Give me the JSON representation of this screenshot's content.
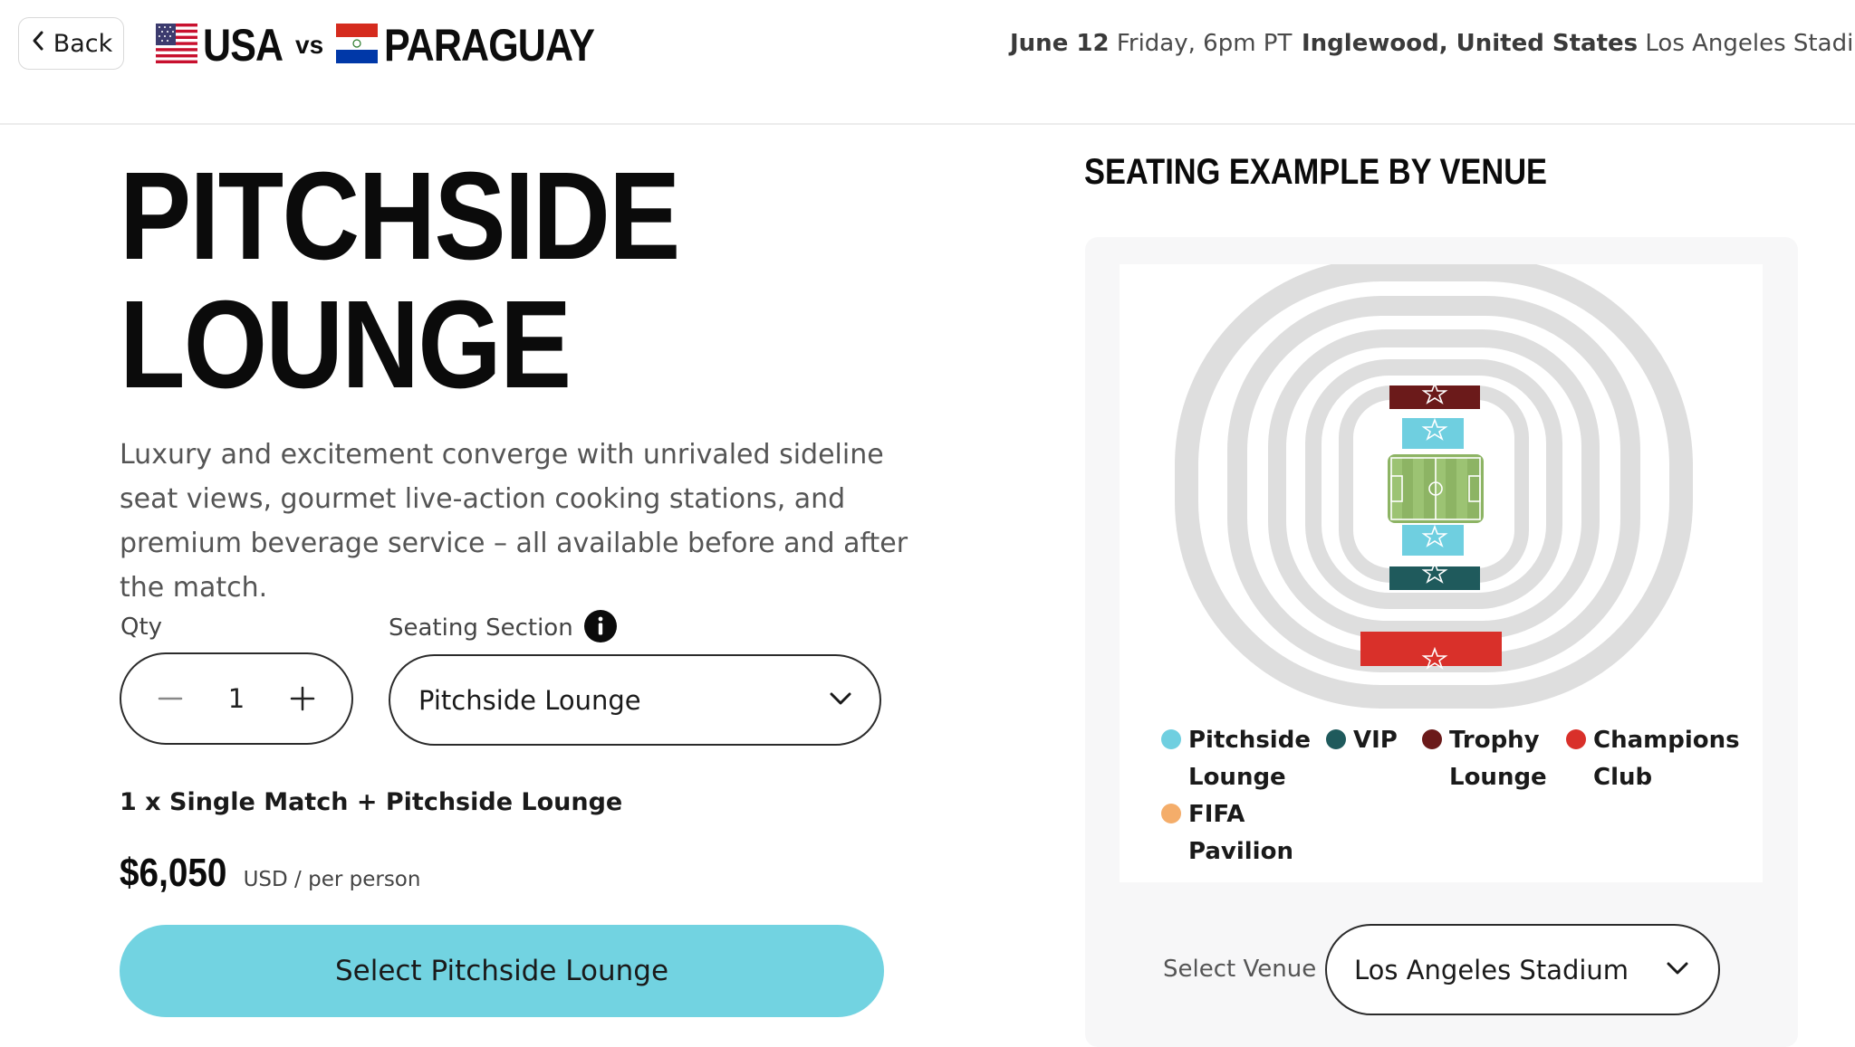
{
  "header": {
    "back_label": "Back",
    "team_home": "USA",
    "vs_label": "vs",
    "team_away": "PARAGUAY",
    "date_bold": "June 12",
    "date_rest": "Friday, 6pm PT",
    "location_bold": "Inglewood, United States",
    "location_rest": "Los Angeles Stadium"
  },
  "product": {
    "title_line1": "PITCHSIDE",
    "title_line2": "LOUNGE",
    "description": "Luxury and excitement converge with unrivaled sideline seat views, gourmet live-action cooking stations, and premium beverage service – all available before and after the match.",
    "qty_label": "Qty",
    "qty_value": "1",
    "section_label": "Seating Section",
    "section_value": "Pitchside Lounge",
    "summary": "1 x Single Match + Pitchside Lounge",
    "price": "$6,050",
    "price_unit": "USD / per person",
    "cta_label": "Select Pitchside Lounge"
  },
  "venue_panel": {
    "title": "SEATING EXAMPLE BY VENUE",
    "legend": [
      {
        "label": "Pitchside Lounge",
        "color": "#6fcfe0"
      },
      {
        "label": "VIP",
        "color": "#1f5a5c"
      },
      {
        "label": "Trophy Lounge",
        "color": "#6b1a1a"
      },
      {
        "label": "Champions Club",
        "color": "#d9302a"
      },
      {
        "label": "FIFA Pavilion",
        "color": "#f4ad6a"
      }
    ],
    "select_label": "Select Venue",
    "select_value": "Los Angeles Stadium"
  },
  "colors": {
    "accent": "#72d3e1",
    "pitch": "#8db464",
    "rings": "#dddddd"
  }
}
